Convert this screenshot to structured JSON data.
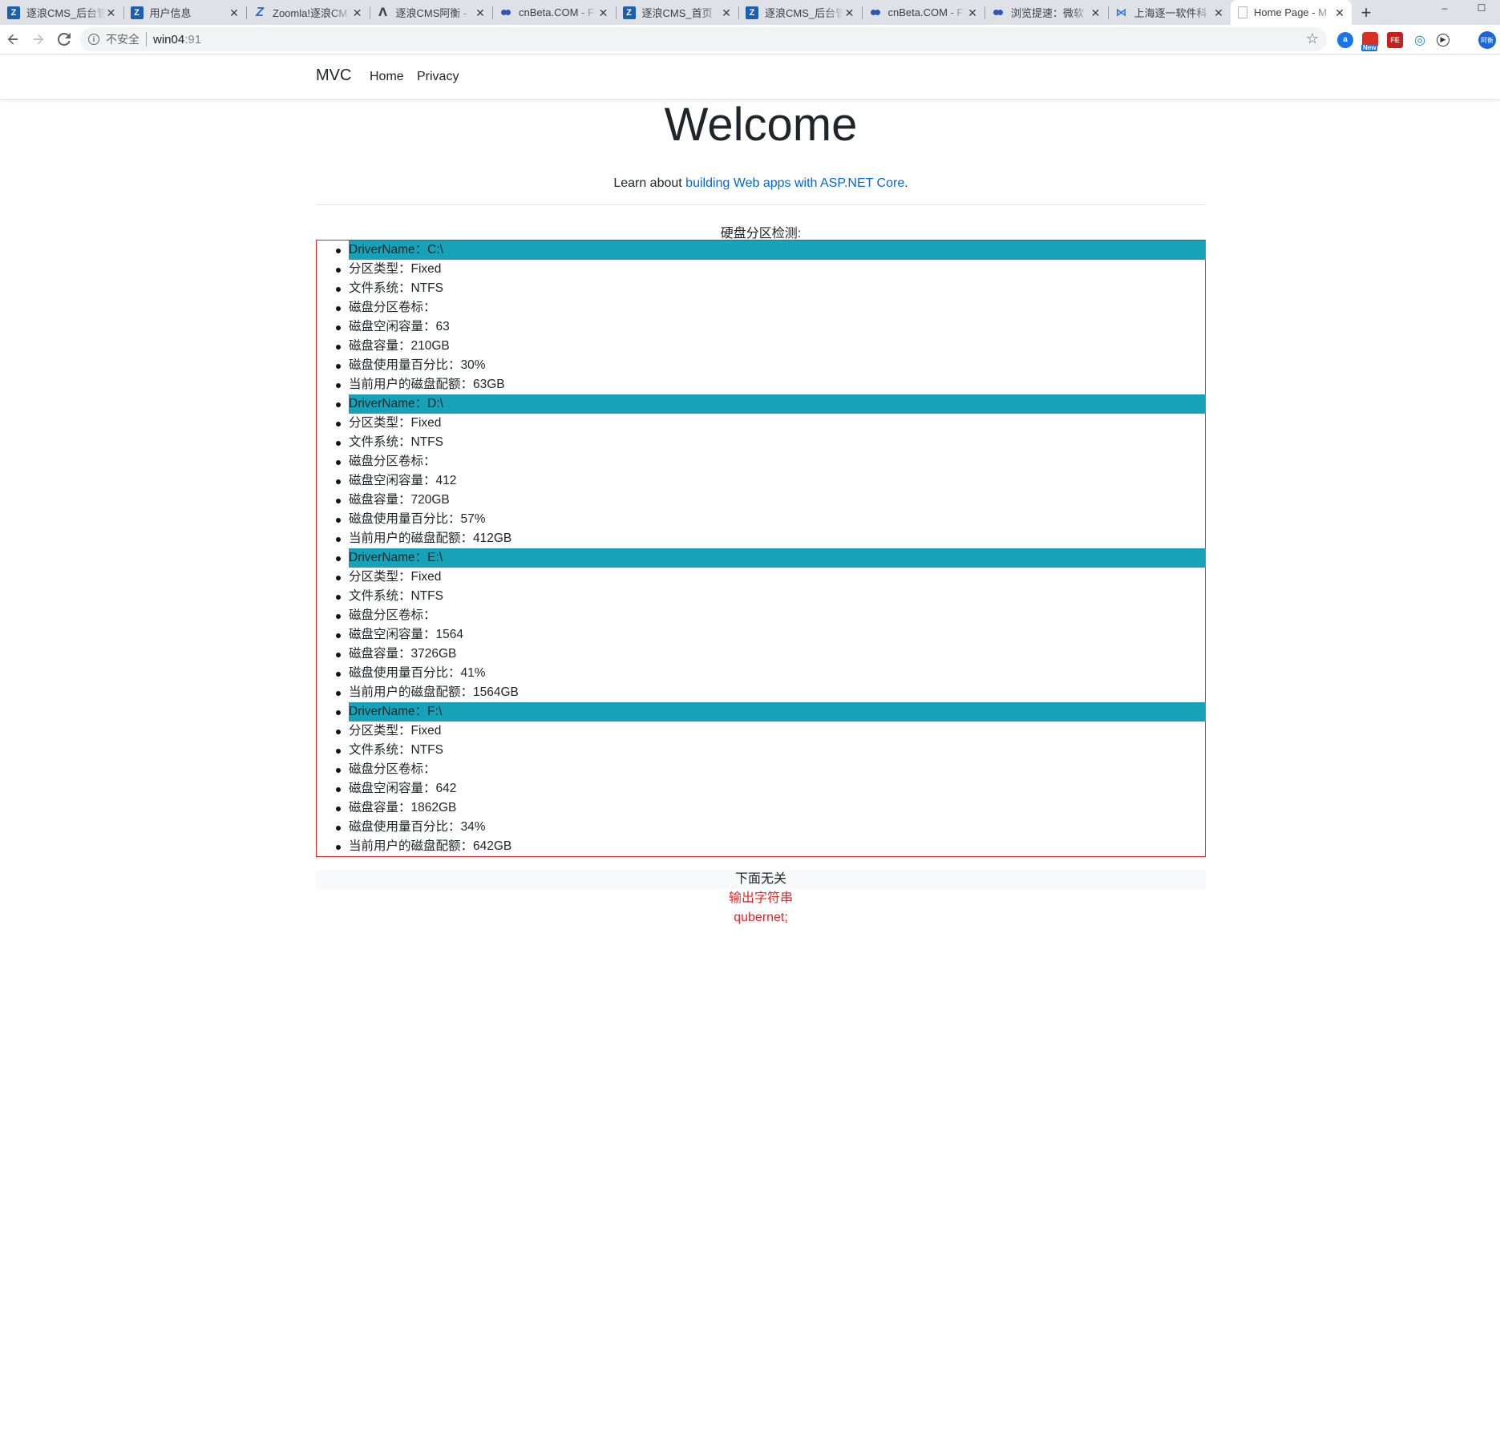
{
  "browser": {
    "tabs": [
      {
        "icon": "z-icon",
        "title": "逐浪CMS_后台管",
        "active": false
      },
      {
        "icon": "z-icon",
        "title": "用户信息",
        "active": false
      },
      {
        "icon": "joomla-icon",
        "title": "Zoomla!逐浪CM",
        "active": false
      },
      {
        "icon": "aliyun-icon",
        "title": "逐浪CMS阿衡 -",
        "active": false
      },
      {
        "icon": "cnbeta-icon",
        "title": "cnBeta.COM - F",
        "active": false
      },
      {
        "icon": "z-icon",
        "title": "逐浪CMS_首页",
        "active": false
      },
      {
        "icon": "z-icon",
        "title": "逐浪CMS_后台管",
        "active": false
      },
      {
        "icon": "cnbeta-icon",
        "title": "cnBeta.COM - F",
        "active": false
      },
      {
        "icon": "cnbeta-icon",
        "title": "浏览提速：微软",
        "active": false
      },
      {
        "icon": "visual-studio-icon",
        "title": "上海逐一软件科",
        "active": false
      },
      {
        "icon": "page-icon",
        "title": "Home Page - M",
        "active": true
      }
    ],
    "new_tab": "+",
    "window_controls": {
      "minimize": "–",
      "maximize": "☐"
    },
    "insecure_label": "不安全",
    "url_host": "win04",
    "url_port": ":91",
    "extensions": [
      {
        "name": "extension-a-icon",
        "label": "a"
      },
      {
        "name": "extension-new-icon",
        "label": "",
        "badge": "New"
      },
      {
        "name": "extension-fe-icon",
        "label": "FE"
      },
      {
        "name": "extension-swirl-icon",
        "label": "◎"
      },
      {
        "name": "extension-play-icon",
        "label": "▶"
      }
    ],
    "profile_label": "阿衡"
  },
  "site": {
    "brand": "MVC",
    "nav": {
      "home": "Home",
      "privacy": "Privacy"
    },
    "welcome": "Welcome",
    "learn_prefix": "Learn about ",
    "learn_link": "building Web apps with ASP.NET Core",
    "learn_suffix": ".",
    "disk_heading": "硬盘分区检测:",
    "disk_items": [
      {
        "text": "DriverName：C:\\",
        "drive": true
      },
      {
        "text": "分区类型：Fixed",
        "drive": false
      },
      {
        "text": "文件系统：NTFS",
        "drive": false
      },
      {
        "text": "磁盘分区卷标：",
        "drive": false
      },
      {
        "text": "磁盘空闲容量：63",
        "drive": false
      },
      {
        "text": "磁盘容量：210GB",
        "drive": false
      },
      {
        "text": "磁盘使用量百分比：30%",
        "drive": false
      },
      {
        "text": "当前用户的磁盘配额：63GB",
        "drive": false
      },
      {
        "text": "DriverName：D:\\",
        "drive": true
      },
      {
        "text": "分区类型：Fixed",
        "drive": false
      },
      {
        "text": "文件系统：NTFS",
        "drive": false
      },
      {
        "text": "磁盘分区卷标：",
        "drive": false
      },
      {
        "text": "磁盘空闲容量：412",
        "drive": false
      },
      {
        "text": "磁盘容量：720GB",
        "drive": false
      },
      {
        "text": "磁盘使用量百分比：57%",
        "drive": false
      },
      {
        "text": "当前用户的磁盘配额：412GB",
        "drive": false
      },
      {
        "text": "DriverName：E:\\",
        "drive": true
      },
      {
        "text": "分区类型：Fixed",
        "drive": false
      },
      {
        "text": "文件系统：NTFS",
        "drive": false
      },
      {
        "text": "磁盘分区卷标：",
        "drive": false
      },
      {
        "text": "磁盘空闲容量：1564",
        "drive": false
      },
      {
        "text": "磁盘容量：3726GB",
        "drive": false
      },
      {
        "text": "磁盘使用量百分比：41%",
        "drive": false
      },
      {
        "text": "当前用户的磁盘配额：1564GB",
        "drive": false
      },
      {
        "text": "DriverName：F:\\",
        "drive": true
      },
      {
        "text": "分区类型：Fixed",
        "drive": false
      },
      {
        "text": "文件系统：NTFS",
        "drive": false
      },
      {
        "text": "磁盘分区卷标：",
        "drive": false
      },
      {
        "text": "磁盘空闲容量：642",
        "drive": false
      },
      {
        "text": "磁盘容量：1862GB",
        "drive": false
      },
      {
        "text": "磁盘使用量百分比：34%",
        "drive": false
      },
      {
        "text": "当前用户的磁盘配额：642GB",
        "drive": false
      }
    ],
    "below_text": "下面无关",
    "output_label": "输出字符串",
    "output_value": "qubernet;"
  },
  "colors": {
    "drive_highlight": "#17a2b8",
    "box_border": "#e02424",
    "red_text": "#e02424",
    "link": "#0366d6"
  }
}
